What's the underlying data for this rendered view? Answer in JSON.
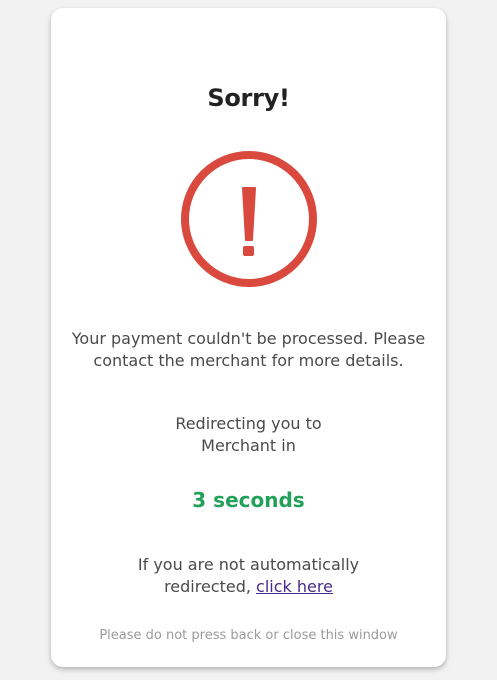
{
  "card": {
    "title": "Sorry!",
    "icon": "exclamation-circle-icon",
    "message_line1": "Your payment couldn't be processed. Please",
    "message_line2": "contact the merchant for more details.",
    "redirect_line1": "Redirecting you to",
    "redirect_line2": "Merchant in",
    "countdown": "3 seconds",
    "manual_line1": "If you are not automatically",
    "manual_prefix": "redirected, ",
    "manual_link": "click here",
    "footnote": "Please do not press back or close this window"
  },
  "colors": {
    "error": "#d9493e",
    "success": "#23a05a",
    "link": "#4a2a8a"
  }
}
